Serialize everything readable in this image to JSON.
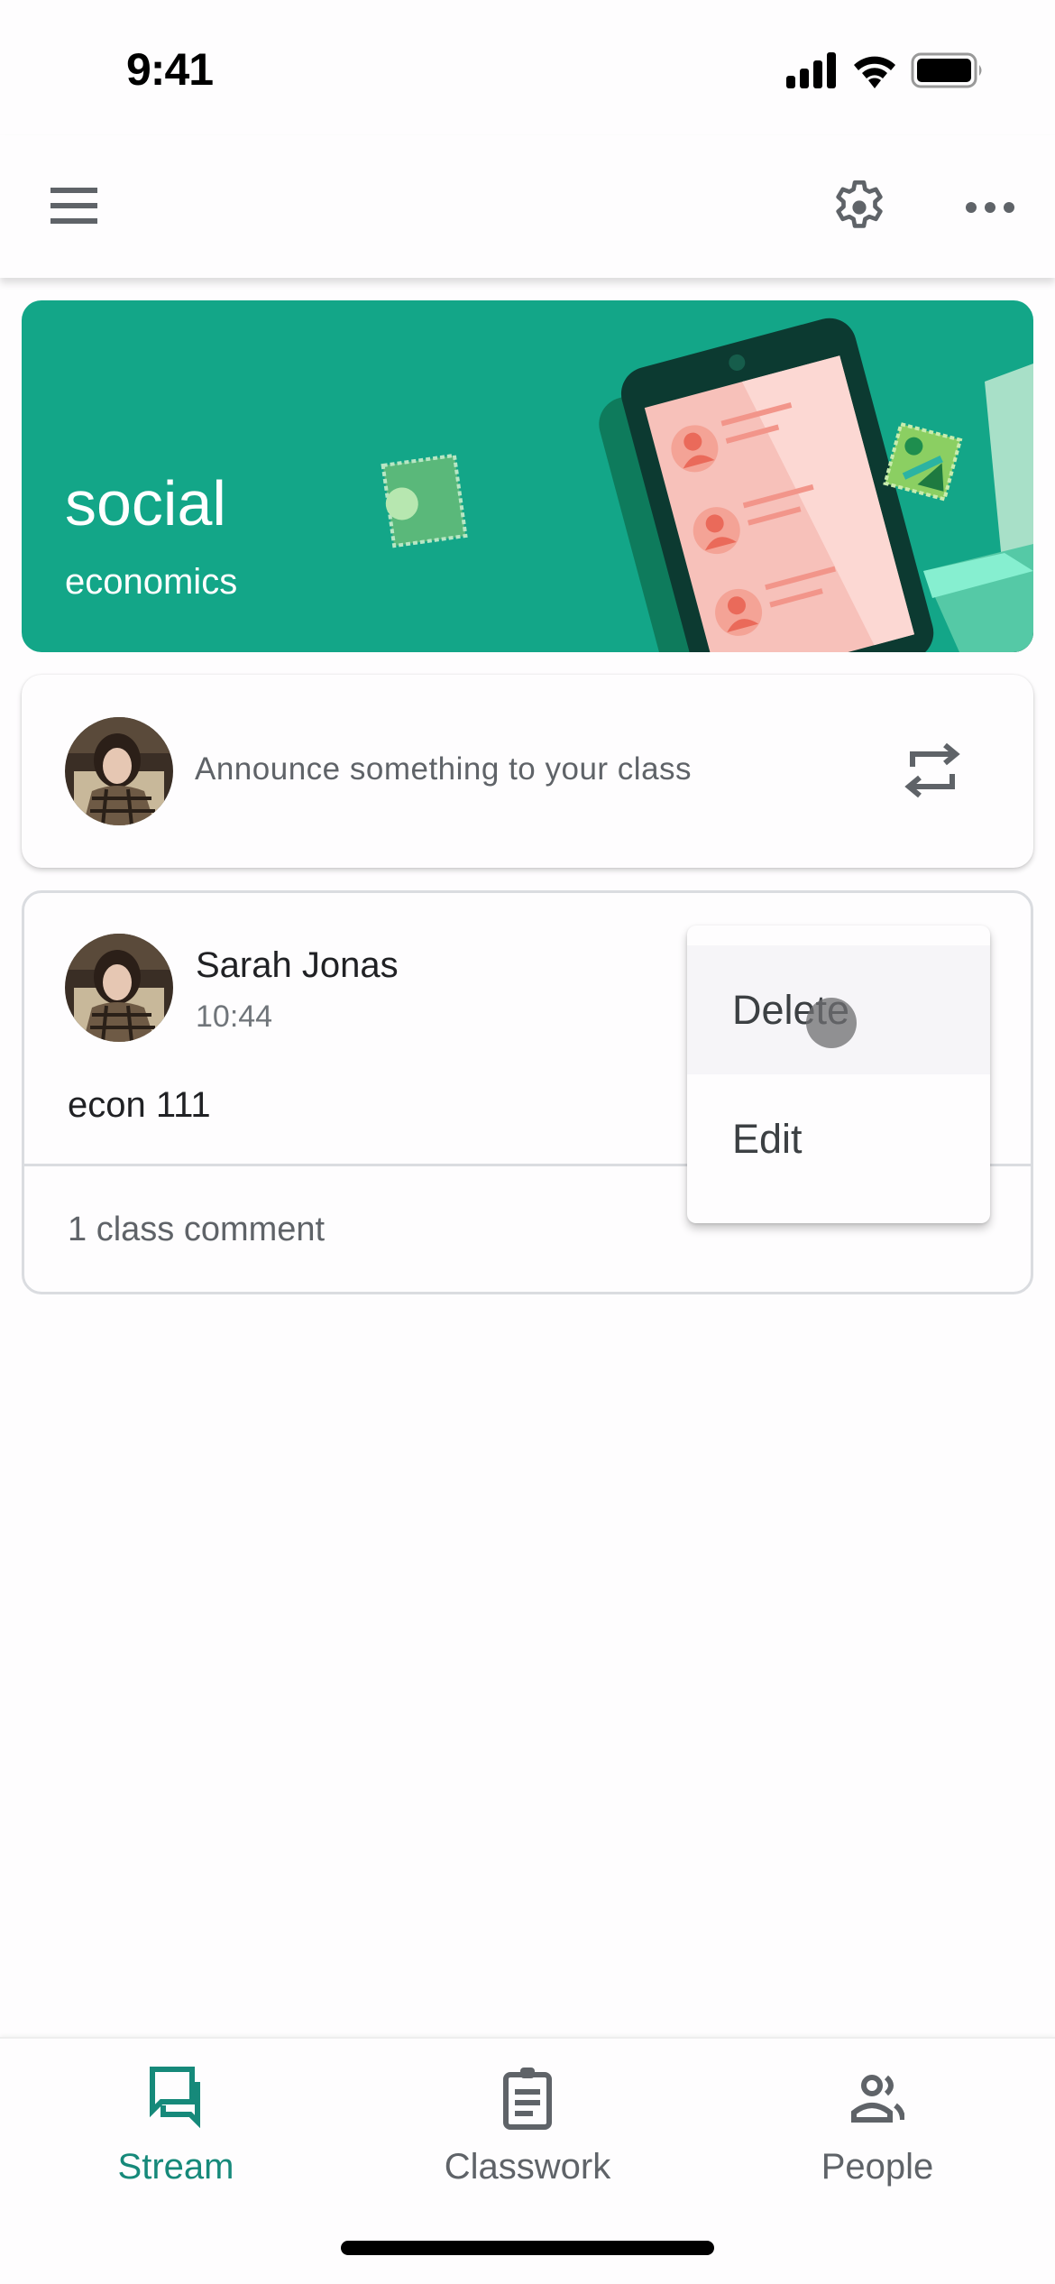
{
  "status_bar": {
    "time": "9:41",
    "icons": [
      "cellular-signal-icon",
      "wifi-icon",
      "battery-icon"
    ]
  },
  "app_bar": {
    "icons": [
      "hamburger-menu-icon",
      "gear-icon",
      "more-horizontal-icon"
    ]
  },
  "banner": {
    "title": "social",
    "subtitle": "economics",
    "theme_color": "#13a688"
  },
  "announce": {
    "placeholder": "Announce something to your class",
    "icon": "repost-arrows-icon"
  },
  "post": {
    "author": "Sarah Jonas",
    "time": "10:44",
    "body": "econ 111",
    "comments": "1 class comment"
  },
  "context_menu": {
    "items": [
      {
        "label": "Delete",
        "highlighted": true
      },
      {
        "label": "Edit",
        "highlighted": false
      }
    ]
  },
  "bottom_nav": {
    "items": [
      {
        "label": "Stream",
        "icon": "stream-chat-icon",
        "active": true
      },
      {
        "label": "Classwork",
        "icon": "clipboard-icon",
        "active": false
      },
      {
        "label": "People",
        "icon": "people-icon",
        "active": false
      }
    ],
    "active_color": "#16897a"
  }
}
